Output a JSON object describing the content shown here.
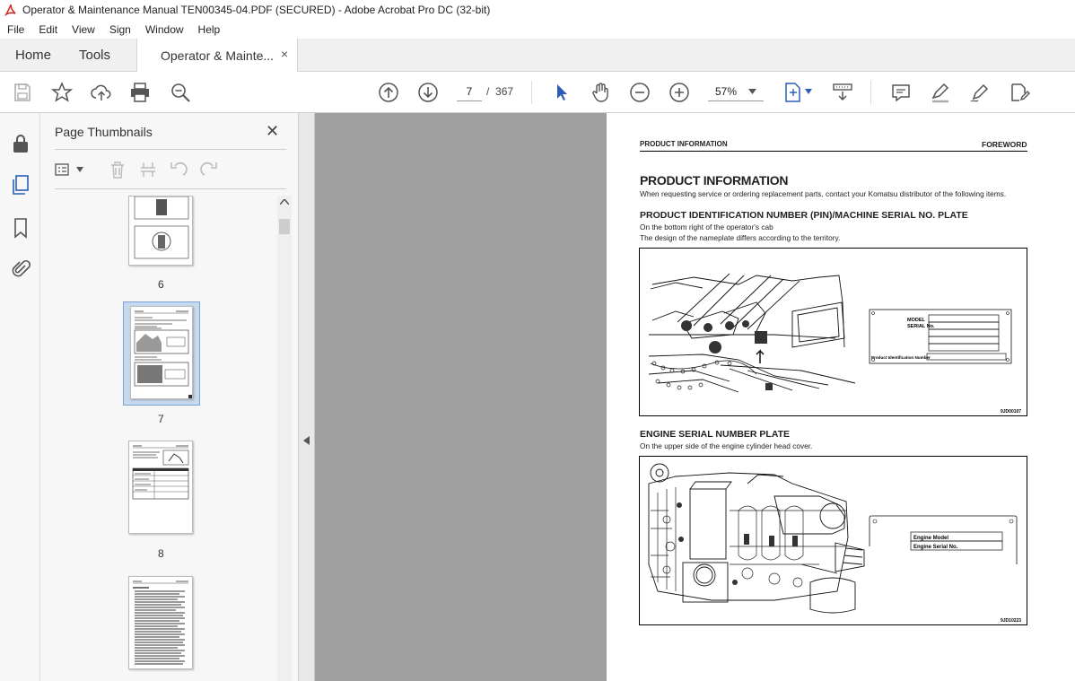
{
  "window": {
    "title": "Operator & Maintenance Manual TEN00345-04.PDF (SECURED) - Adobe Acrobat Pro DC (32-bit)"
  },
  "menu": [
    "File",
    "Edit",
    "View",
    "Sign",
    "Window",
    "Help"
  ],
  "tabs": {
    "home": "Home",
    "tools": "Tools",
    "document": "Operator & Mainte...",
    "close": "×"
  },
  "toolbar": {
    "current_page": "7",
    "page_separator": "/",
    "total_pages": "367",
    "zoom": "57%"
  },
  "thumbnails": {
    "title": "Page Thumbnails",
    "close": "✕",
    "pages": [
      "6",
      "7",
      "8"
    ],
    "selected": "7"
  },
  "document": {
    "header_left": "PRODUCT INFORMATION",
    "header_right": "FOREWORD",
    "heading": "PRODUCT INFORMATION",
    "intro": "When requesting service or ordering replacement parts, contact your Komatsu distributor of the following items.",
    "section1": {
      "title": "PRODUCT IDENTIFICATION NUMBER (PIN)/MACHINE SERIAL NO. PLATE",
      "line1": "On the bottom right of the operator's cab",
      "line2": "The design of the nameplate differs according to the territory.",
      "plate_model": "MODEL",
      "plate_serial": "SERIAL No.",
      "plate_pin": "Product Identification Number",
      "figure_code": "9JD00107"
    },
    "section2": {
      "title": "ENGINE SERIAL NUMBER PLATE",
      "line1": "On the upper side of the engine cylinder head cover.",
      "plate_model": "Engine Model",
      "plate_serial": "Engine Serial No.",
      "figure_code": "9JD10223"
    }
  }
}
